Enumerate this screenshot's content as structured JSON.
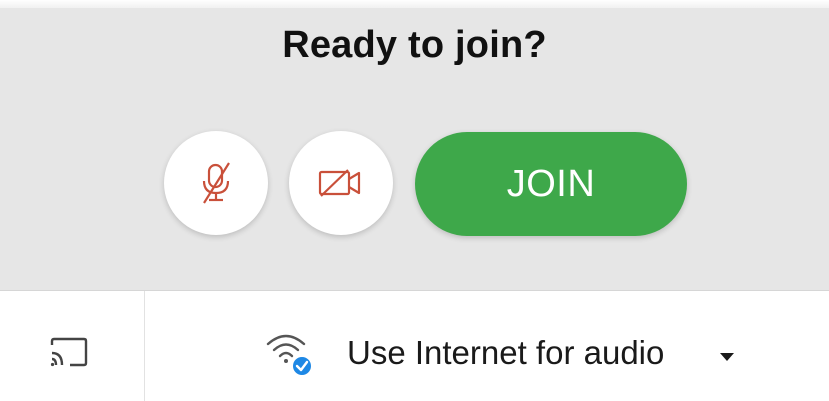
{
  "header": {
    "title": "Ready to join?"
  },
  "controls": {
    "mic_icon": "mic-off-icon",
    "camera_icon": "video-off-icon",
    "join_label": "JOIN"
  },
  "bottom_bar": {
    "cast_icon": "cast-icon",
    "audio_icon": "wifi-check-icon",
    "audio_option_label": "Use Internet for audio"
  },
  "colors": {
    "panel_background": "#e6e6e6",
    "join_green": "#3ea84a",
    "icon_red": "#c9503a",
    "check_blue": "#1e88e5"
  }
}
